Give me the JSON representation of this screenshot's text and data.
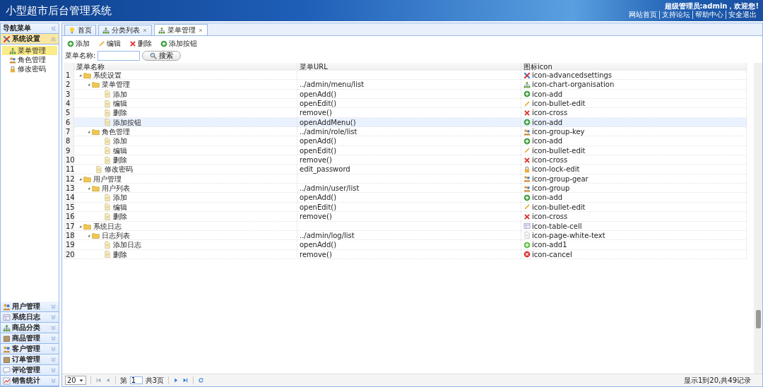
{
  "header": {
    "title": "小型超市后台管理系统",
    "welcome": "超级管理员:admin，欢迎您!",
    "links": [
      "网站首页",
      "支持论坛",
      "帮助中心",
      "安全退出"
    ]
  },
  "sidebar": {
    "title": "导航菜单",
    "sections": [
      {
        "label": "系统设置",
        "kind": "settings",
        "expanded": true,
        "items": [
          {
            "label": "菜单管理",
            "kind": "org",
            "selected": true
          },
          {
            "label": "角色管理",
            "kind": "group",
            "selected": false
          },
          {
            "label": "修改密码",
            "kind": "lock",
            "selected": false
          }
        ]
      },
      {
        "label": "用户管理",
        "kind": "group",
        "expanded": false
      },
      {
        "label": "系统日志",
        "kind": "table",
        "expanded": false
      },
      {
        "label": "商品分类",
        "kind": "org",
        "expanded": false
      },
      {
        "label": "商品管理",
        "kind": "box",
        "expanded": false
      },
      {
        "label": "客户管理",
        "kind": "group",
        "expanded": false
      },
      {
        "label": "订单管理",
        "kind": "box",
        "expanded": false
      },
      {
        "label": "评论管理",
        "kind": "comment",
        "expanded": false
      },
      {
        "label": "销售统计",
        "kind": "chart",
        "expanded": false
      }
    ]
  },
  "tabs": [
    {
      "label": "首页",
      "kind": "bulb",
      "closable": false,
      "selected": false
    },
    {
      "label": "分类列表",
      "kind": "org",
      "closable": true,
      "selected": false
    },
    {
      "label": "菜单管理",
      "kind": "org",
      "closable": true,
      "selected": true
    }
  ],
  "toolbar": [
    {
      "label": "添加",
      "kind": "add"
    },
    {
      "label": "编辑",
      "kind": "edit"
    },
    {
      "label": "删除",
      "kind": "cross"
    },
    {
      "label": "添加按钮",
      "kind": "add"
    }
  ],
  "search": {
    "label": "菜单名称:",
    "button": "搜索"
  },
  "table": {
    "columns": [
      "菜单名称",
      "菜单URL",
      "图标icon"
    ],
    "rows": [
      {
        "num": "1",
        "name": "系统设置",
        "url": "",
        "icon": "icon-advancedsettings",
        "kind": "settings",
        "expanded": true,
        "selected": false,
        "children": [
          {
            "num": "2",
            "name": "菜单管理",
            "url": "../admin/menu/list",
            "icon": "icon-chart-organisation",
            "kind": "org",
            "expanded": true,
            "selected": false,
            "children": [
              {
                "num": "3",
                "name": "添加",
                "url": "openAdd()",
                "icon": "icon-add",
                "kind": "add",
                "selected": false
              },
              {
                "num": "4",
                "name": "编辑",
                "url": "openEdit()",
                "icon": "icon-bullet-edit",
                "kind": "edit",
                "selected": false
              },
              {
                "num": "5",
                "name": "删除",
                "url": "remove()",
                "icon": "icon-cross",
                "kind": "cross",
                "selected": false
              },
              {
                "num": "6",
                "name": "添加按钮",
                "url": "openAddMenu()",
                "icon": "icon-add",
                "kind": "add",
                "selected": true
              }
            ]
          },
          {
            "num": "7",
            "name": "角色管理",
            "url": "../admin/role/list",
            "icon": "icon-group-key",
            "kind": "group",
            "expanded": true,
            "selected": false,
            "children": [
              {
                "num": "8",
                "name": "添加",
                "url": "openAdd()",
                "icon": "icon-add",
                "kind": "add",
                "selected": false
              },
              {
                "num": "9",
                "name": "编辑",
                "url": "openEdit()",
                "icon": "icon-bullet-edit",
                "kind": "edit",
                "selected": false
              },
              {
                "num": "10",
                "name": "删除",
                "url": "remove()",
                "icon": "icon-cross",
                "kind": "cross",
                "selected": false
              }
            ]
          },
          {
            "num": "11",
            "name": "修改密码",
            "url": "edit_password",
            "icon": "icon-lock-edit",
            "kind": "lock",
            "selected": false
          }
        ]
      },
      {
        "num": "12",
        "name": "用户管理",
        "url": "",
        "icon": "icon-group-gear",
        "kind": "group",
        "expanded": true,
        "selected": false,
        "children": [
          {
            "num": "13",
            "name": "用户列表",
            "url": "../admin/user/list",
            "icon": "icon-group",
            "kind": "group",
            "expanded": true,
            "selected": false,
            "children": [
              {
                "num": "14",
                "name": "添加",
                "url": "openAdd()",
                "icon": "icon-add",
                "kind": "add",
                "selected": false
              },
              {
                "num": "15",
                "name": "编辑",
                "url": "openEdit()",
                "icon": "icon-bullet-edit",
                "kind": "edit",
                "selected": false
              },
              {
                "num": "16",
                "name": "删除",
                "url": "remove()",
                "icon": "icon-cross",
                "kind": "cross",
                "selected": false
              }
            ]
          }
        ]
      },
      {
        "num": "17",
        "name": "系统日志",
        "url": "",
        "icon": "icon-table-cell",
        "kind": "table",
        "expanded": true,
        "selected": false,
        "children": [
          {
            "num": "18",
            "name": "日志列表",
            "url": "../admin/log/list",
            "icon": "icon-page-white-text",
            "kind": "page",
            "expanded": true,
            "selected": false,
            "children": [
              {
                "num": "19",
                "name": "添加日志",
                "url": "openAdd()",
                "icon": "icon-add1",
                "kind": "add1",
                "selected": false
              },
              {
                "num": "20",
                "name": "删除",
                "url": "remove()",
                "icon": "icon-cancel",
                "kind": "cancel",
                "selected": false
              }
            ]
          }
        ]
      }
    ]
  },
  "pager": {
    "page_size": "20",
    "page_prefix": "第",
    "page": "1",
    "page_total": "共3页",
    "summary": "显示1到20,共49记录"
  }
}
